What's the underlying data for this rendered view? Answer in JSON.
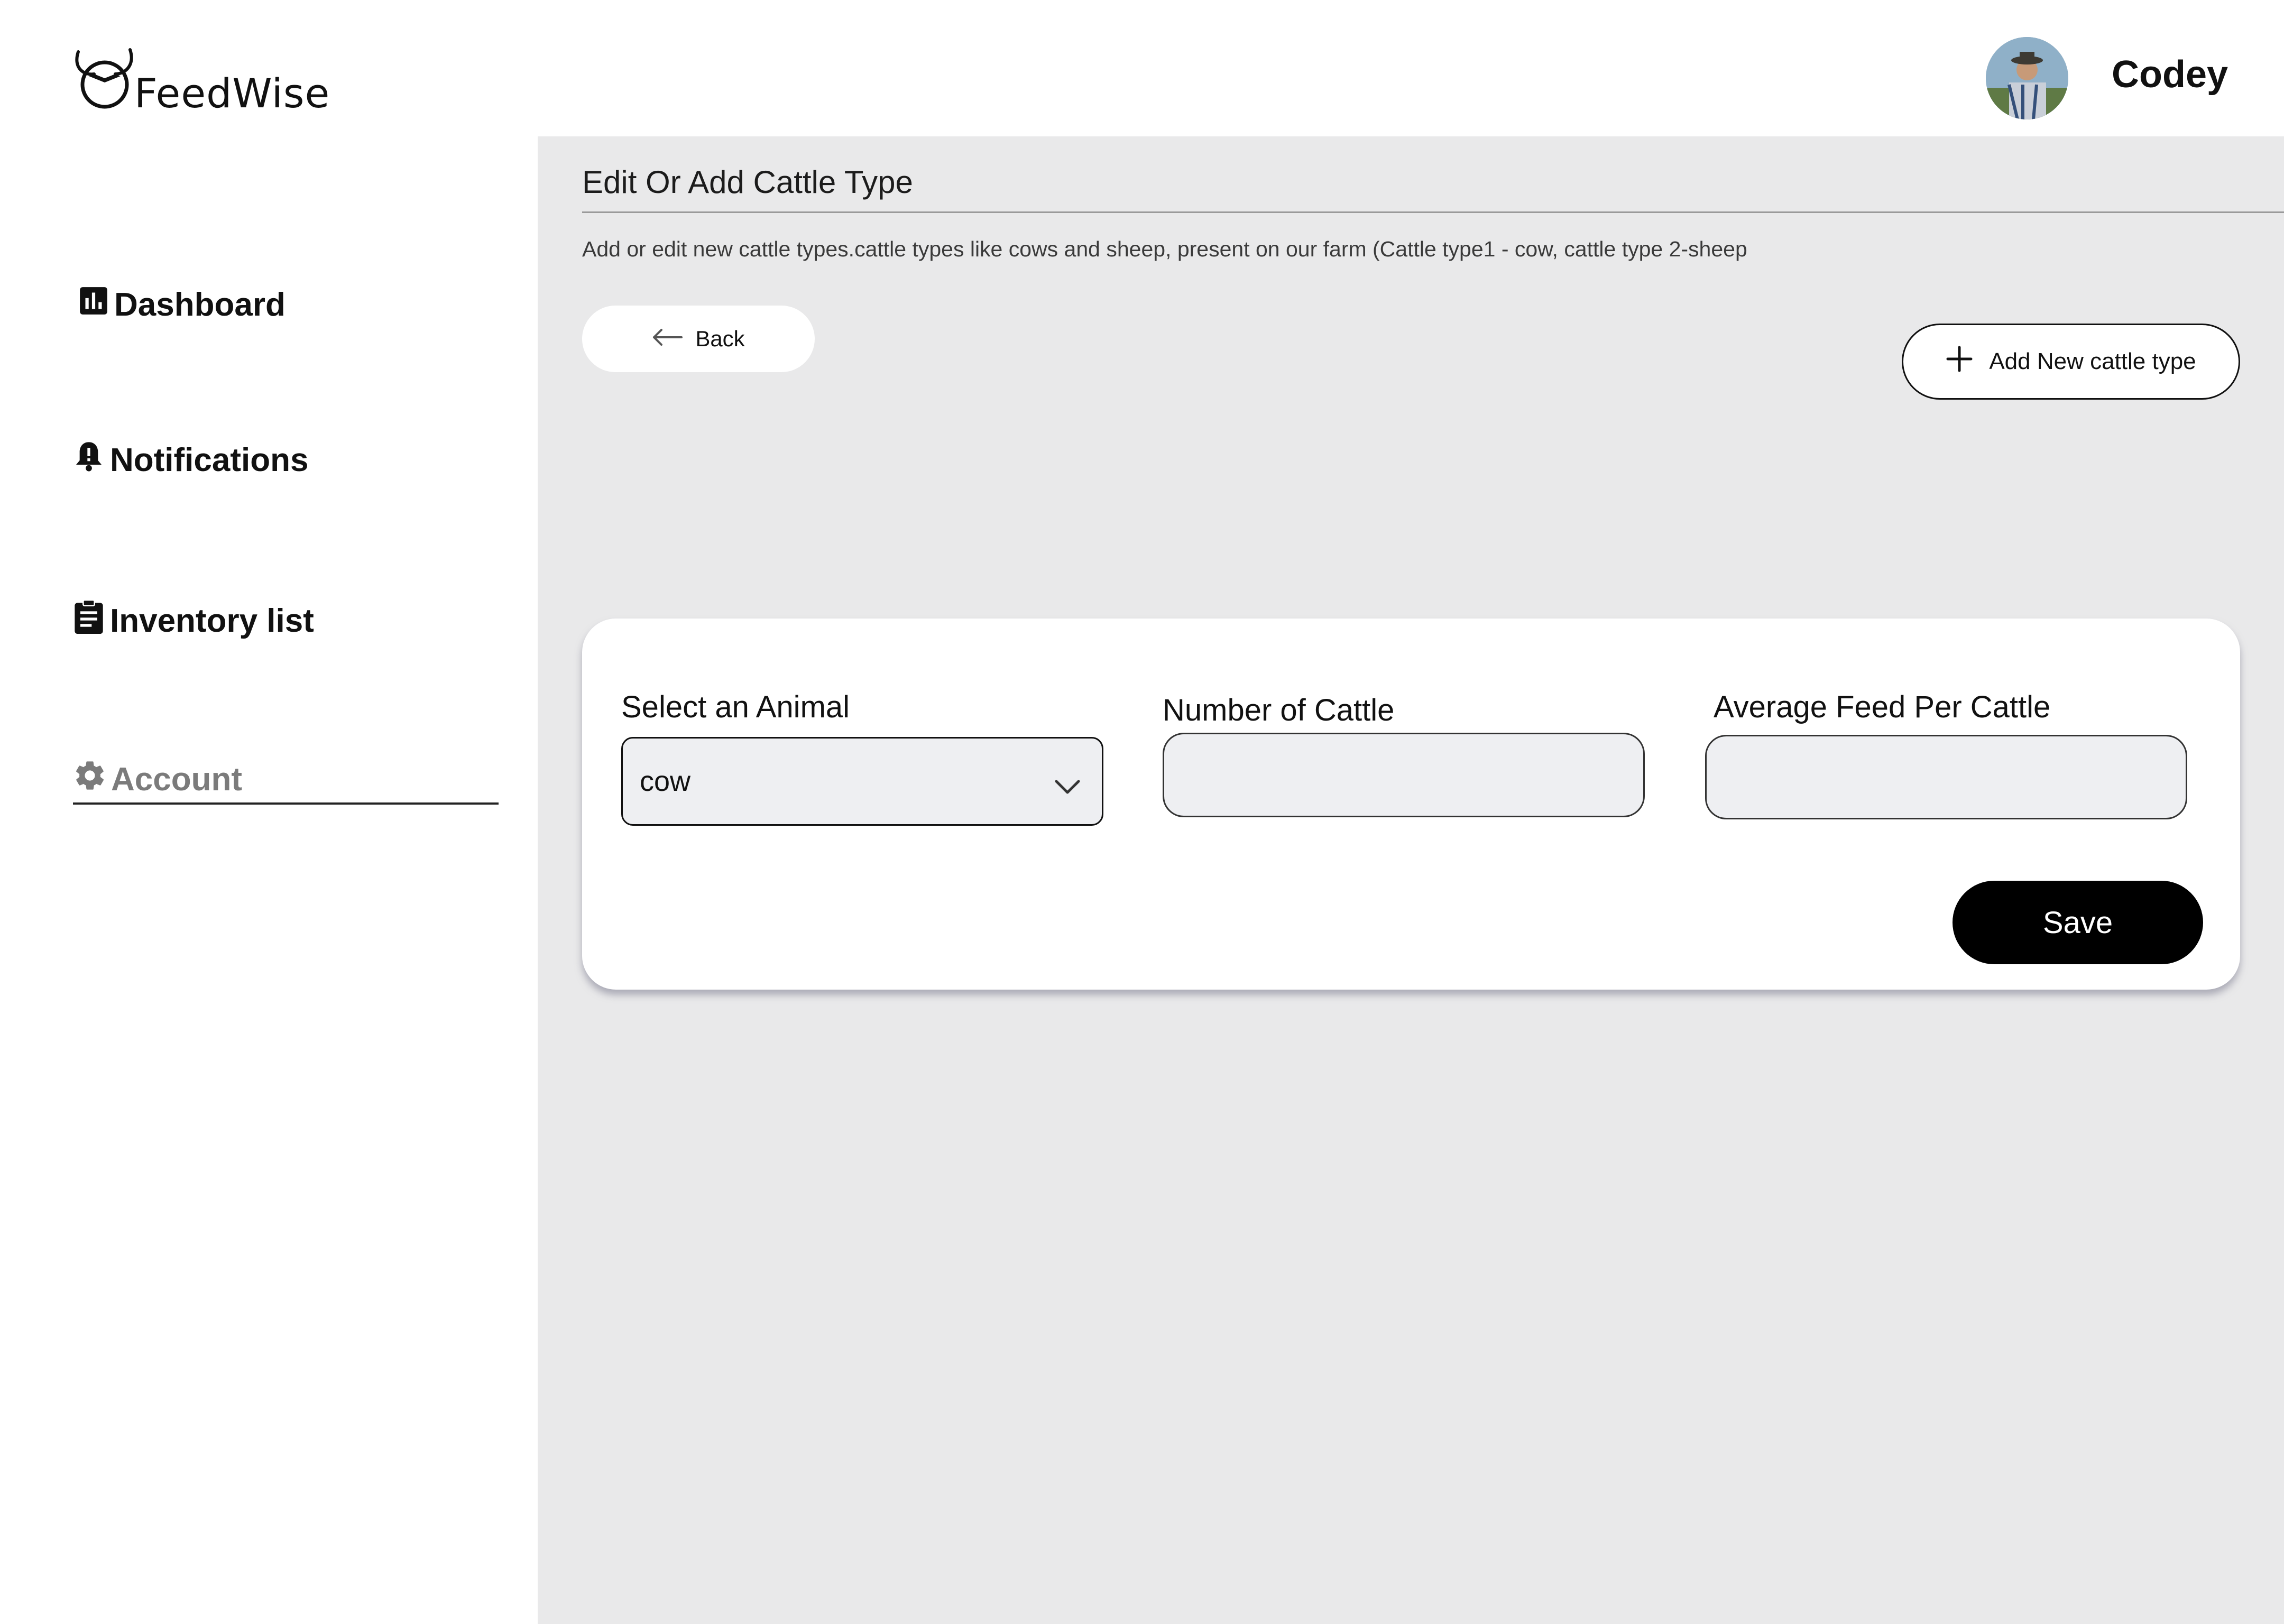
{
  "app": {
    "name": "FeedWise"
  },
  "user": {
    "name": "Codey"
  },
  "sidebar": {
    "items": [
      {
        "label": "Dashboard",
        "icon": "bar-chart-icon",
        "active": false
      },
      {
        "label": "Notifications",
        "icon": "bell-alert-icon",
        "active": false
      },
      {
        "label": "Inventory list",
        "icon": "clipboard-list-icon",
        "active": false
      },
      {
        "label": "Account",
        "icon": "gear-icon",
        "active": true
      }
    ]
  },
  "main": {
    "title": "Edit Or Add Cattle Type",
    "description": "Add or edit new cattle types.cattle types like cows and sheep, present on our farm (Cattle type1 - cow, cattle type 2-sheep",
    "back_label": "Back",
    "add_label": "Add New cattle type",
    "form": {
      "animal_label": "Select an Animal",
      "animal_value": "cow",
      "number_label": "Number of Cattle",
      "number_value": "",
      "feed_label": "Average Feed Per Cattle",
      "feed_value": "",
      "save_label": "Save"
    }
  },
  "colors": {
    "main_bg": "#e9e9ea",
    "muted_nav": "#7b7b7b",
    "primary_button": "#000000"
  }
}
